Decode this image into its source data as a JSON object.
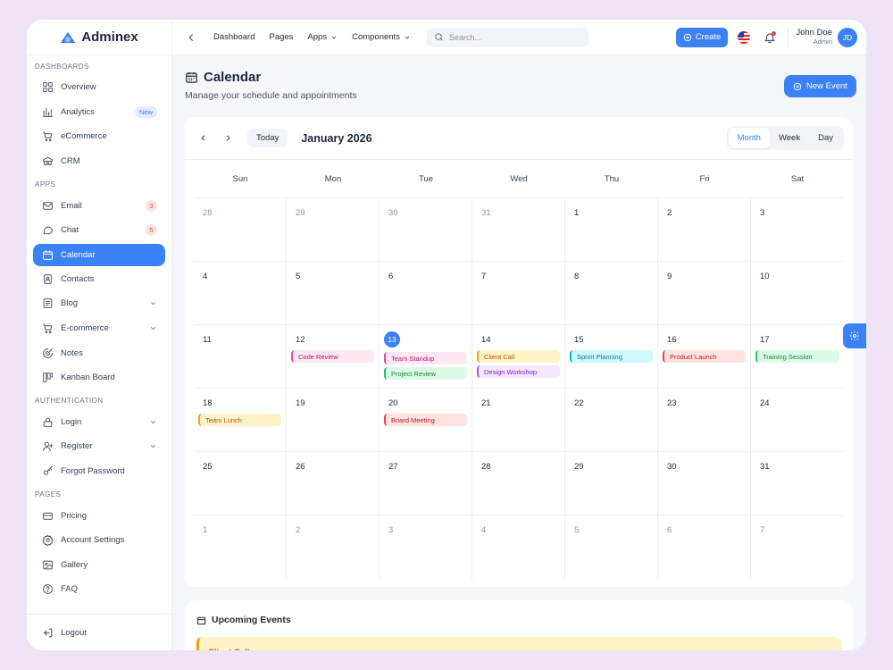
{
  "brand": {
    "name": "Adminex"
  },
  "sidebar": {
    "sections": [
      {
        "title": "DASHBOARDS",
        "items": [
          {
            "label": "Overview",
            "icon": "grid-icon"
          },
          {
            "label": "Analytics",
            "icon": "bar-chart-icon",
            "badge": "New",
            "badge_style": "blue"
          },
          {
            "label": "eCommerce",
            "icon": "cart-icon"
          },
          {
            "label": "CRM",
            "icon": "crm-icon"
          }
        ]
      },
      {
        "title": "APPS",
        "items": [
          {
            "label": "Email",
            "icon": "mail-icon",
            "badge": "3",
            "badge_style": "red"
          },
          {
            "label": "Chat",
            "icon": "chat-icon",
            "badge": "5",
            "badge_style": "red"
          },
          {
            "label": "Calendar",
            "icon": "calendar-icon",
            "active": true
          },
          {
            "label": "Contacts",
            "icon": "contacts-icon"
          },
          {
            "label": "Blog",
            "icon": "blog-icon",
            "chevron": true
          },
          {
            "label": "E-commerce",
            "icon": "cart-icon",
            "chevron": true
          },
          {
            "label": "Notes",
            "icon": "notes-icon"
          },
          {
            "label": "Kanban Board",
            "icon": "kanban-icon"
          }
        ]
      },
      {
        "title": "AUTHENTICATION",
        "items": [
          {
            "label": "Login",
            "icon": "lock-icon",
            "chevron": true
          },
          {
            "label": "Register",
            "icon": "user-plus-icon",
            "chevron": true
          },
          {
            "label": "Forgot Password",
            "icon": "key-icon"
          }
        ]
      },
      {
        "title": "PAGES",
        "items": [
          {
            "label": "Pricing",
            "icon": "card-icon"
          },
          {
            "label": "Account Settings",
            "icon": "gear-icon"
          },
          {
            "label": "Gallery",
            "icon": "image-icon"
          },
          {
            "label": "FAQ",
            "icon": "help-icon"
          }
        ]
      }
    ],
    "logout_label": "Logout"
  },
  "topbar": {
    "nav": [
      {
        "label": "Dashboard",
        "chevron": false
      },
      {
        "label": "Pages",
        "chevron": false
      },
      {
        "label": "Apps",
        "chevron": true
      },
      {
        "label": "Components",
        "chevron": true
      }
    ],
    "search_placeholder": "Search...",
    "create_label": "Create",
    "user": {
      "name": "John Doe",
      "role": "Admin",
      "initials": "JD"
    }
  },
  "page": {
    "title": "Calendar",
    "subtitle": "Manage your schedule and appointments",
    "new_event_label": "New Event"
  },
  "calendar": {
    "today_label": "Today",
    "month_label": "January 2026",
    "views": [
      "Month",
      "Week",
      "Day"
    ],
    "active_view": "Month",
    "weekdays": [
      "Sun",
      "Mon",
      "Tue",
      "Wed",
      "Thu",
      "Fri",
      "Sat"
    ],
    "weeks": [
      [
        {
          "d": "28",
          "m": true
        },
        {
          "d": "29",
          "m": true
        },
        {
          "d": "30",
          "m": true
        },
        {
          "d": "31",
          "m": true
        },
        {
          "d": "1"
        },
        {
          "d": "2"
        },
        {
          "d": "3"
        }
      ],
      [
        {
          "d": "4"
        },
        {
          "d": "5"
        },
        {
          "d": "6"
        },
        {
          "d": "7"
        },
        {
          "d": "8"
        },
        {
          "d": "9"
        },
        {
          "d": "10"
        }
      ],
      [
        {
          "d": "11"
        },
        {
          "d": "12",
          "events": [
            {
              "label": "Code Review",
              "color": "pink"
            }
          ]
        },
        {
          "d": "13",
          "today": true,
          "events": [
            {
              "label": "Team Standup",
              "color": "pink"
            },
            {
              "label": "Project Review",
              "color": "green"
            }
          ]
        },
        {
          "d": "14",
          "events": [
            {
              "label": "Client Call",
              "color": "yellow"
            },
            {
              "label": "Design Workshop",
              "color": "purple"
            }
          ]
        },
        {
          "d": "15",
          "events": [
            {
              "label": "Sprint Planning",
              "color": "cyan"
            }
          ]
        },
        {
          "d": "16",
          "events": [
            {
              "label": "Product Launch",
              "color": "red"
            }
          ]
        },
        {
          "d": "17",
          "events": [
            {
              "label": "Training Session",
              "color": "green"
            }
          ]
        }
      ],
      [
        {
          "d": "18",
          "events": [
            {
              "label": "Team Lunch",
              "color": "yellow"
            }
          ]
        },
        {
          "d": "19"
        },
        {
          "d": "20",
          "events": [
            {
              "label": "Board Meeting",
              "color": "red"
            }
          ]
        },
        {
          "d": "21"
        },
        {
          "d": "22"
        },
        {
          "d": "23"
        },
        {
          "d": "24"
        }
      ],
      [
        {
          "d": "25"
        },
        {
          "d": "26"
        },
        {
          "d": "27"
        },
        {
          "d": "28"
        },
        {
          "d": "29"
        },
        {
          "d": "30"
        },
        {
          "d": "31"
        }
      ],
      [
        {
          "d": "1",
          "m": true
        },
        {
          "d": "2",
          "m": true
        },
        {
          "d": "3",
          "m": true
        },
        {
          "d": "4",
          "m": true
        },
        {
          "d": "5",
          "m": true
        },
        {
          "d": "6",
          "m": true
        },
        {
          "d": "7",
          "m": true
        }
      ]
    ]
  },
  "event_colors": {
    "pink": {
      "bg": "#fce7f3",
      "border": "#ec4899",
      "text": "#be185d"
    },
    "green": {
      "bg": "#dcfce7",
      "border": "#22c55e",
      "text": "#15803d"
    },
    "yellow": {
      "bg": "#fef3c7",
      "border": "#f59e0b",
      "text": "#b45309"
    },
    "purple": {
      "bg": "#f3e8ff",
      "border": "#a855f7",
      "text": "#7e22ce"
    },
    "cyan": {
      "bg": "#cffafe",
      "border": "#06b6d4",
      "text": "#0e7490"
    },
    "red": {
      "bg": "#fee2e2",
      "border": "#ef4444",
      "text": "#b91c1c"
    }
  },
  "upcoming": {
    "title": "Upcoming Events",
    "first_item": "Client Call"
  },
  "colors": {
    "accent": "#3b82f6"
  }
}
